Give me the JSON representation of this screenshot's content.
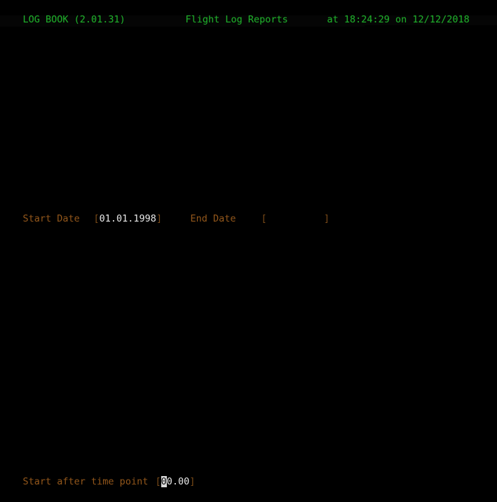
{
  "app": {
    "name": "LOG BOOK",
    "version": "(2.01.31)",
    "title_line": "LOG BOOK (2.01.31)"
  },
  "header": {
    "app_title": "LOG BOOK (2.01.31)",
    "screen_title": "Flight Log Reports",
    "timestamp": "at 18:24:29 on 12/12/2018",
    "time": "18:24:29",
    "date": "12/12/2018",
    "color": "#1faa2a"
  },
  "form": {
    "start_date": {
      "label": "Start Date",
      "open_bracket": "[",
      "value": "01.01.1998",
      "close_bracket": "]"
    },
    "end_date": {
      "label": "End Date",
      "open_bracket": "[",
      "value": "          ",
      "placeholder": "",
      "close_bracket": "]"
    },
    "time_point": {
      "label": "Start after time point",
      "open_bracket": "[",
      "cursor_char": "0",
      "value_rest": "0.00",
      "value": "00.00",
      "close_bracket": "]"
    }
  },
  "colors": {
    "background": "#000000",
    "header_green": "#1faa2a",
    "label_amber": "#93571b",
    "bracket_amber": "#7a4a18",
    "value_white": "#e9e9e9",
    "cursor_bg": "#d9d9d9",
    "cursor_fg": "#0a0a0a"
  }
}
